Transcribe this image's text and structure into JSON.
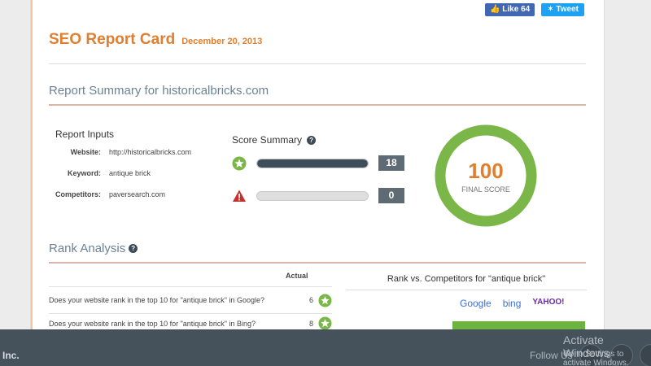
{
  "social": {
    "like_label": "Like 64",
    "tweet_label": "Tweet"
  },
  "header": {
    "title": "SEO Report Card",
    "date": "December 20, 2013"
  },
  "summary": {
    "title": "Report Summary for historicalbricks.com"
  },
  "inputs": {
    "title": "Report Inputs",
    "rows": [
      {
        "label": "Website:",
        "value": "http://historicalbricks.com"
      },
      {
        "label": "Keyword:",
        "value": "antique brick"
      },
      {
        "label": "Competitors:",
        "value": "paversearch.com"
      }
    ]
  },
  "score": {
    "title": "Score Summary",
    "help": "?",
    "passed": {
      "icon": "star-icon",
      "count": "18",
      "fill": 1.0
    },
    "failed": {
      "icon": "warning-icon",
      "count": "0",
      "fill": 0.0
    }
  },
  "final": {
    "value": "100",
    "label": "FINAL SCORE",
    "ring_color": "#7ab648"
  },
  "rank": {
    "title": "Rank Analysis",
    "help": "?",
    "actual_header": "Actual",
    "rows": [
      {
        "question": "Does your website rank in the top 10 for \"antique brick\" in Google?",
        "actual": "6"
      },
      {
        "question": "Does your website rank in the top 10 for \"antique brick\" in Bing?",
        "actual": "8"
      }
    ]
  },
  "competitors": {
    "title": "Rank vs. Competitors for \"antique brick\"",
    "engines": [
      "Google",
      "bing",
      "YAHOO!"
    ]
  },
  "taskbar": {
    "left_text": "Inc.",
    "follow_text": "Follow Us"
  },
  "watermark": {
    "line1": "Activate Windows",
    "line2": "Go to Settings to activate Windows."
  },
  "colors": {
    "accent": "#e07f2f",
    "heading": "#6c8295",
    "success": "#7ab648",
    "danger": "#c9302c"
  }
}
